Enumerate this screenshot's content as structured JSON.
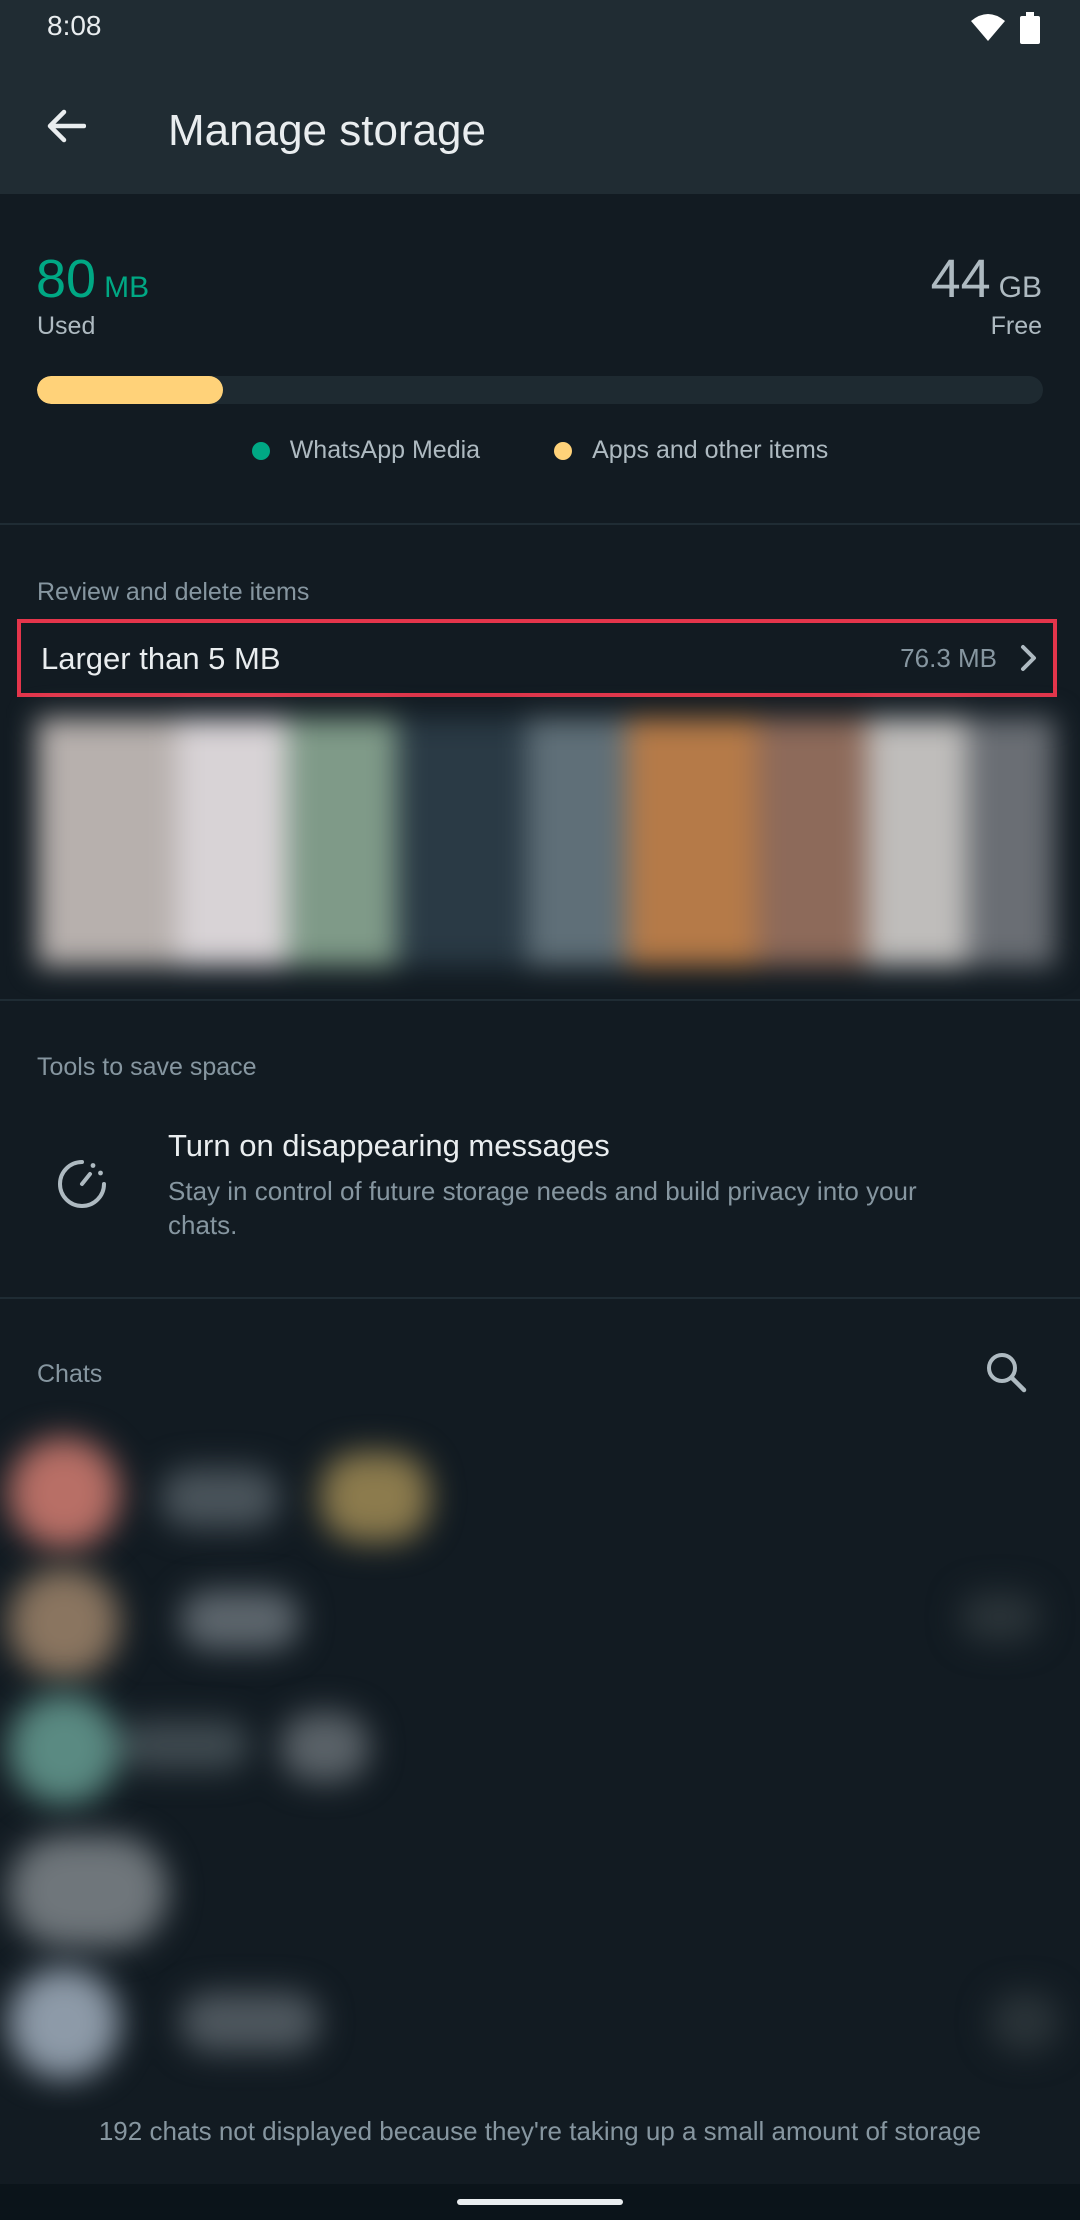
{
  "status_bar": {
    "time": "8:08"
  },
  "app_bar": {
    "title": "Manage storage"
  },
  "storage": {
    "used_value": "80",
    "used_unit": "MB",
    "used_label": "Used",
    "free_value": "44",
    "free_unit": "GB",
    "free_label": "Free",
    "apps_fill_fraction": 0.185,
    "legend": [
      {
        "label": "WhatsApp Media",
        "color": "#00a884"
      },
      {
        "label": "Apps and other items",
        "color": "#ffd279"
      }
    ]
  },
  "review": {
    "heading": "Review and delete items",
    "larger_label": "Larger than 5 MB",
    "larger_size": "76.3 MB"
  },
  "tools": {
    "heading": "Tools to save space",
    "disappearing_title": "Turn on disappearing messages",
    "disappearing_desc": "Stay in control of future storage needs and build privacy into your chats."
  },
  "chats": {
    "heading": "Chats",
    "footer_note": "192 chats not displayed because they're taking up a small amount of storage"
  },
  "colors": {
    "accent": "#00a884",
    "apps_bar": "#ffd279",
    "highlight_border": "#e4354b",
    "background": "#121b22",
    "app_bar": "#202c33"
  },
  "icons": [
    "wifi-icon",
    "battery-icon",
    "back-arrow-icon",
    "chevron-right-icon",
    "disappearing-timer-icon",
    "search-icon"
  ]
}
